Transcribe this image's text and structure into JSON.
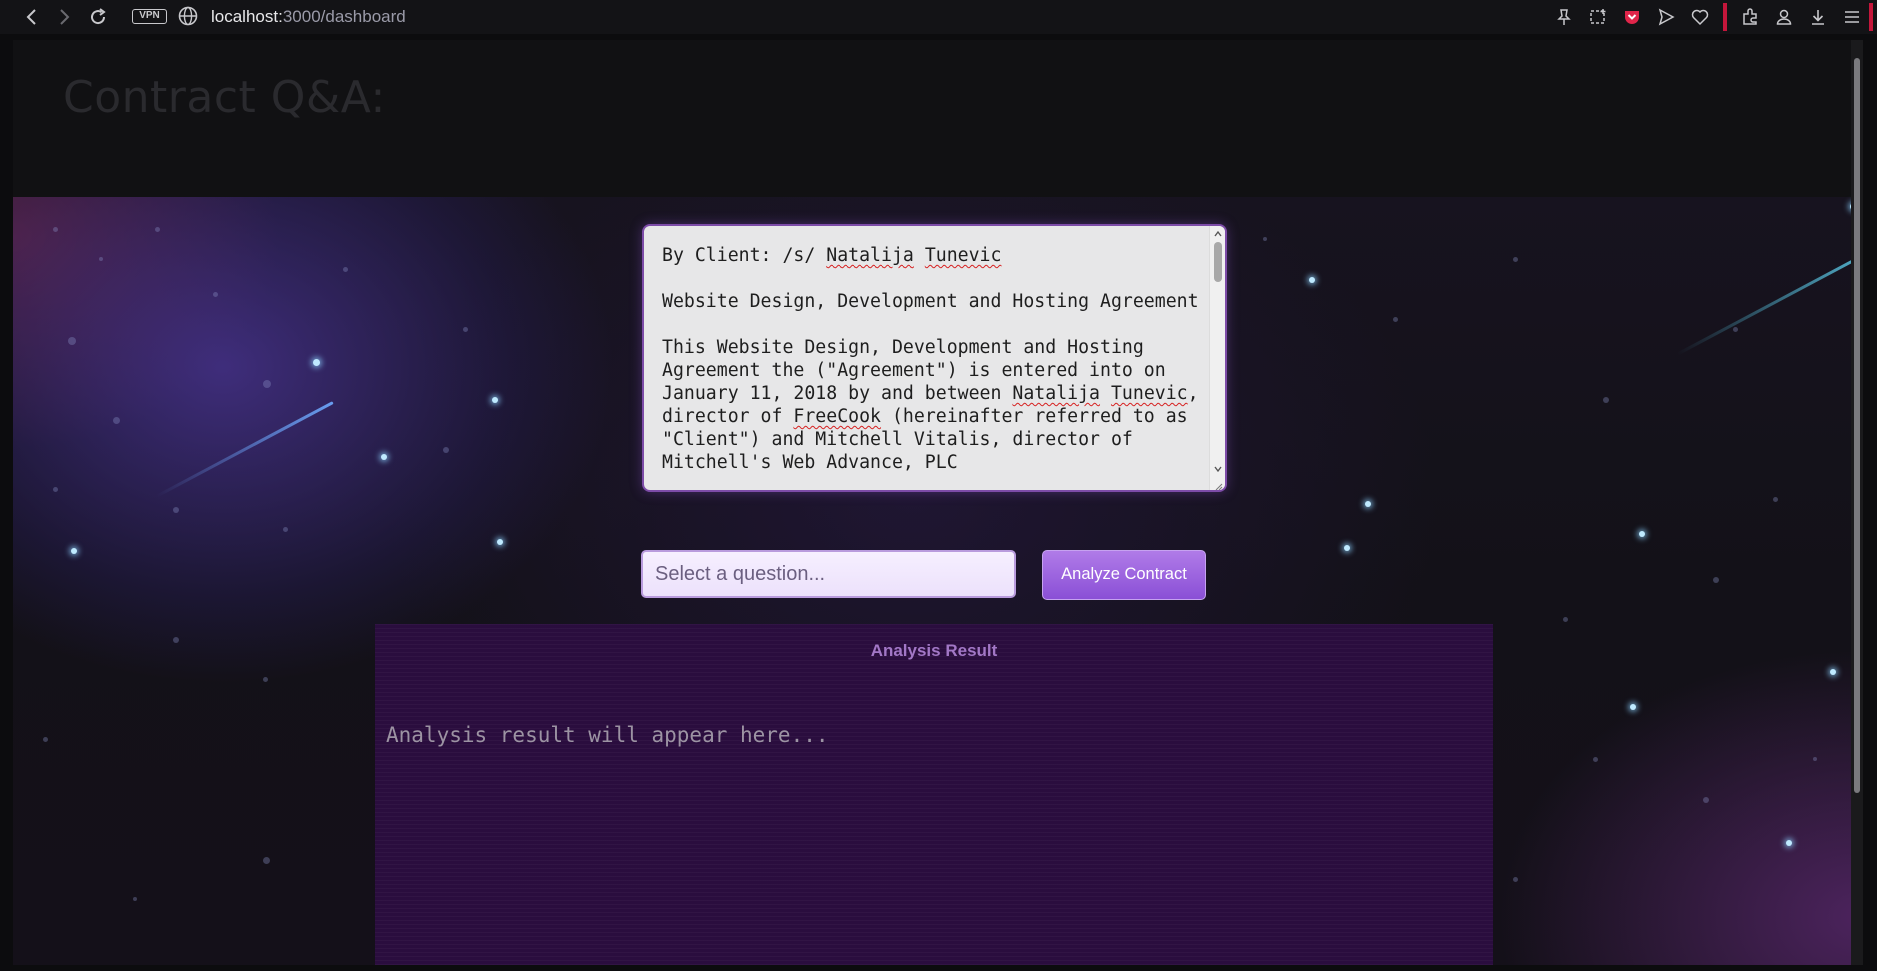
{
  "browser": {
    "vpn_label": "VPN",
    "url_host": "localhost:",
    "url_path": "3000/dashboard",
    "nav": [
      "back-icon",
      "forward-icon",
      "reload-icon"
    ],
    "toolbar_icons": [
      "pin-icon",
      "screenshot-icon",
      "pocket-icon",
      "send-icon",
      "heart-icon",
      "extensions-icon",
      "profile-icon",
      "download-icon",
      "menu-icon"
    ],
    "accent": "#c4163b"
  },
  "page": {
    "title": "Contract Q&A:"
  },
  "contract": {
    "line1_prefix": "By Client: /s/ ",
    "line1_name1": "Natalija",
    "line1_name2": "Tunevic",
    "heading": "Website Design, Development and Hosting Agreement",
    "para_a": "This Website Design, Development and Hosting Agreement the (\"Agreement\") is entered into on January 11, 2018 by and between ",
    "para_name1": "Natalija",
    "para_name2": "Tunevic",
    "para_b": ", director of ",
    "para_company": "FreeCook",
    "para_c": " (hereinafter referred to as \"Client\") and Mitchell Vitalis, director of Mitchell's Web Advance, PLC"
  },
  "question": {
    "placeholder": "Select a question..."
  },
  "analyze_button": {
    "label": "Analyze Contract"
  },
  "result": {
    "title": "Analysis Result",
    "placeholder": "Analysis result will appear here..."
  },
  "colors": {
    "panel": "#2a0d3e",
    "button": "#8a4fd6",
    "textarea_border": "#7d4ca8"
  }
}
